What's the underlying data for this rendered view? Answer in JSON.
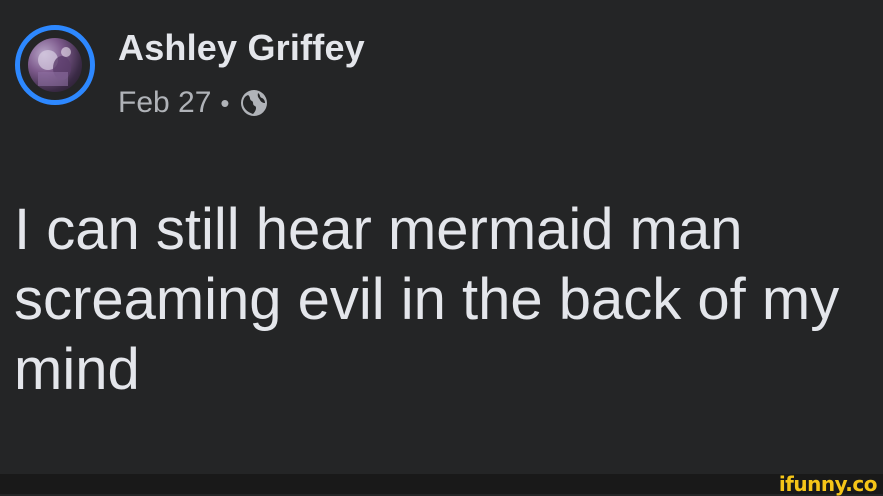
{
  "post": {
    "author_name": "Ashley Griffey",
    "date": "Feb 27",
    "separator": "•",
    "privacy_icon": "globe-icon",
    "text": "I can still hear mermaid man screaming evil in the back of my mind"
  },
  "watermark": {
    "text": "ifunny.co"
  },
  "colors": {
    "background": "#242526",
    "text_primary": "#e4e6eb",
    "text_secondary": "#b0b3b8",
    "avatar_ring": "#2d88ff",
    "watermark": "#f5c518"
  }
}
